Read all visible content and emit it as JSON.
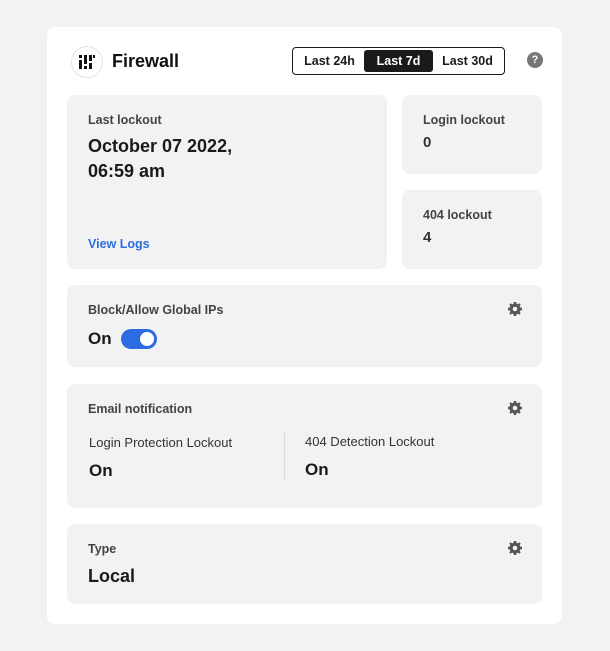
{
  "header": {
    "title": "Firewall",
    "ranges": [
      "Last 24h",
      "Last 7d",
      "Last 30d"
    ],
    "active_range": "Last 7d",
    "help_glyph": "?"
  },
  "last_lockout": {
    "label": "Last lockout",
    "date_line1": "October 07 2022,",
    "date_line2": "06:59 am",
    "link": "View Logs"
  },
  "login_lockout": {
    "label": "Login lockout",
    "value": "0"
  },
  "lockout_404": {
    "label": "404 lockout",
    "value": "4"
  },
  "global_ips": {
    "label": "Block/Allow Global IPs",
    "state": "On",
    "toggle_on": true
  },
  "email": {
    "label": "Email notification",
    "login_protection": {
      "label": "Login Protection Lockout",
      "value": "On"
    },
    "detection_404": {
      "label": "404 Detection Lockout",
      "value": "On"
    }
  },
  "type": {
    "label": "Type",
    "value": "Local"
  },
  "colors": {
    "accent": "#2d6be4",
    "link": "#2a6fe0",
    "panel": "#f2f2f2",
    "dark": "#1a1a1a"
  }
}
